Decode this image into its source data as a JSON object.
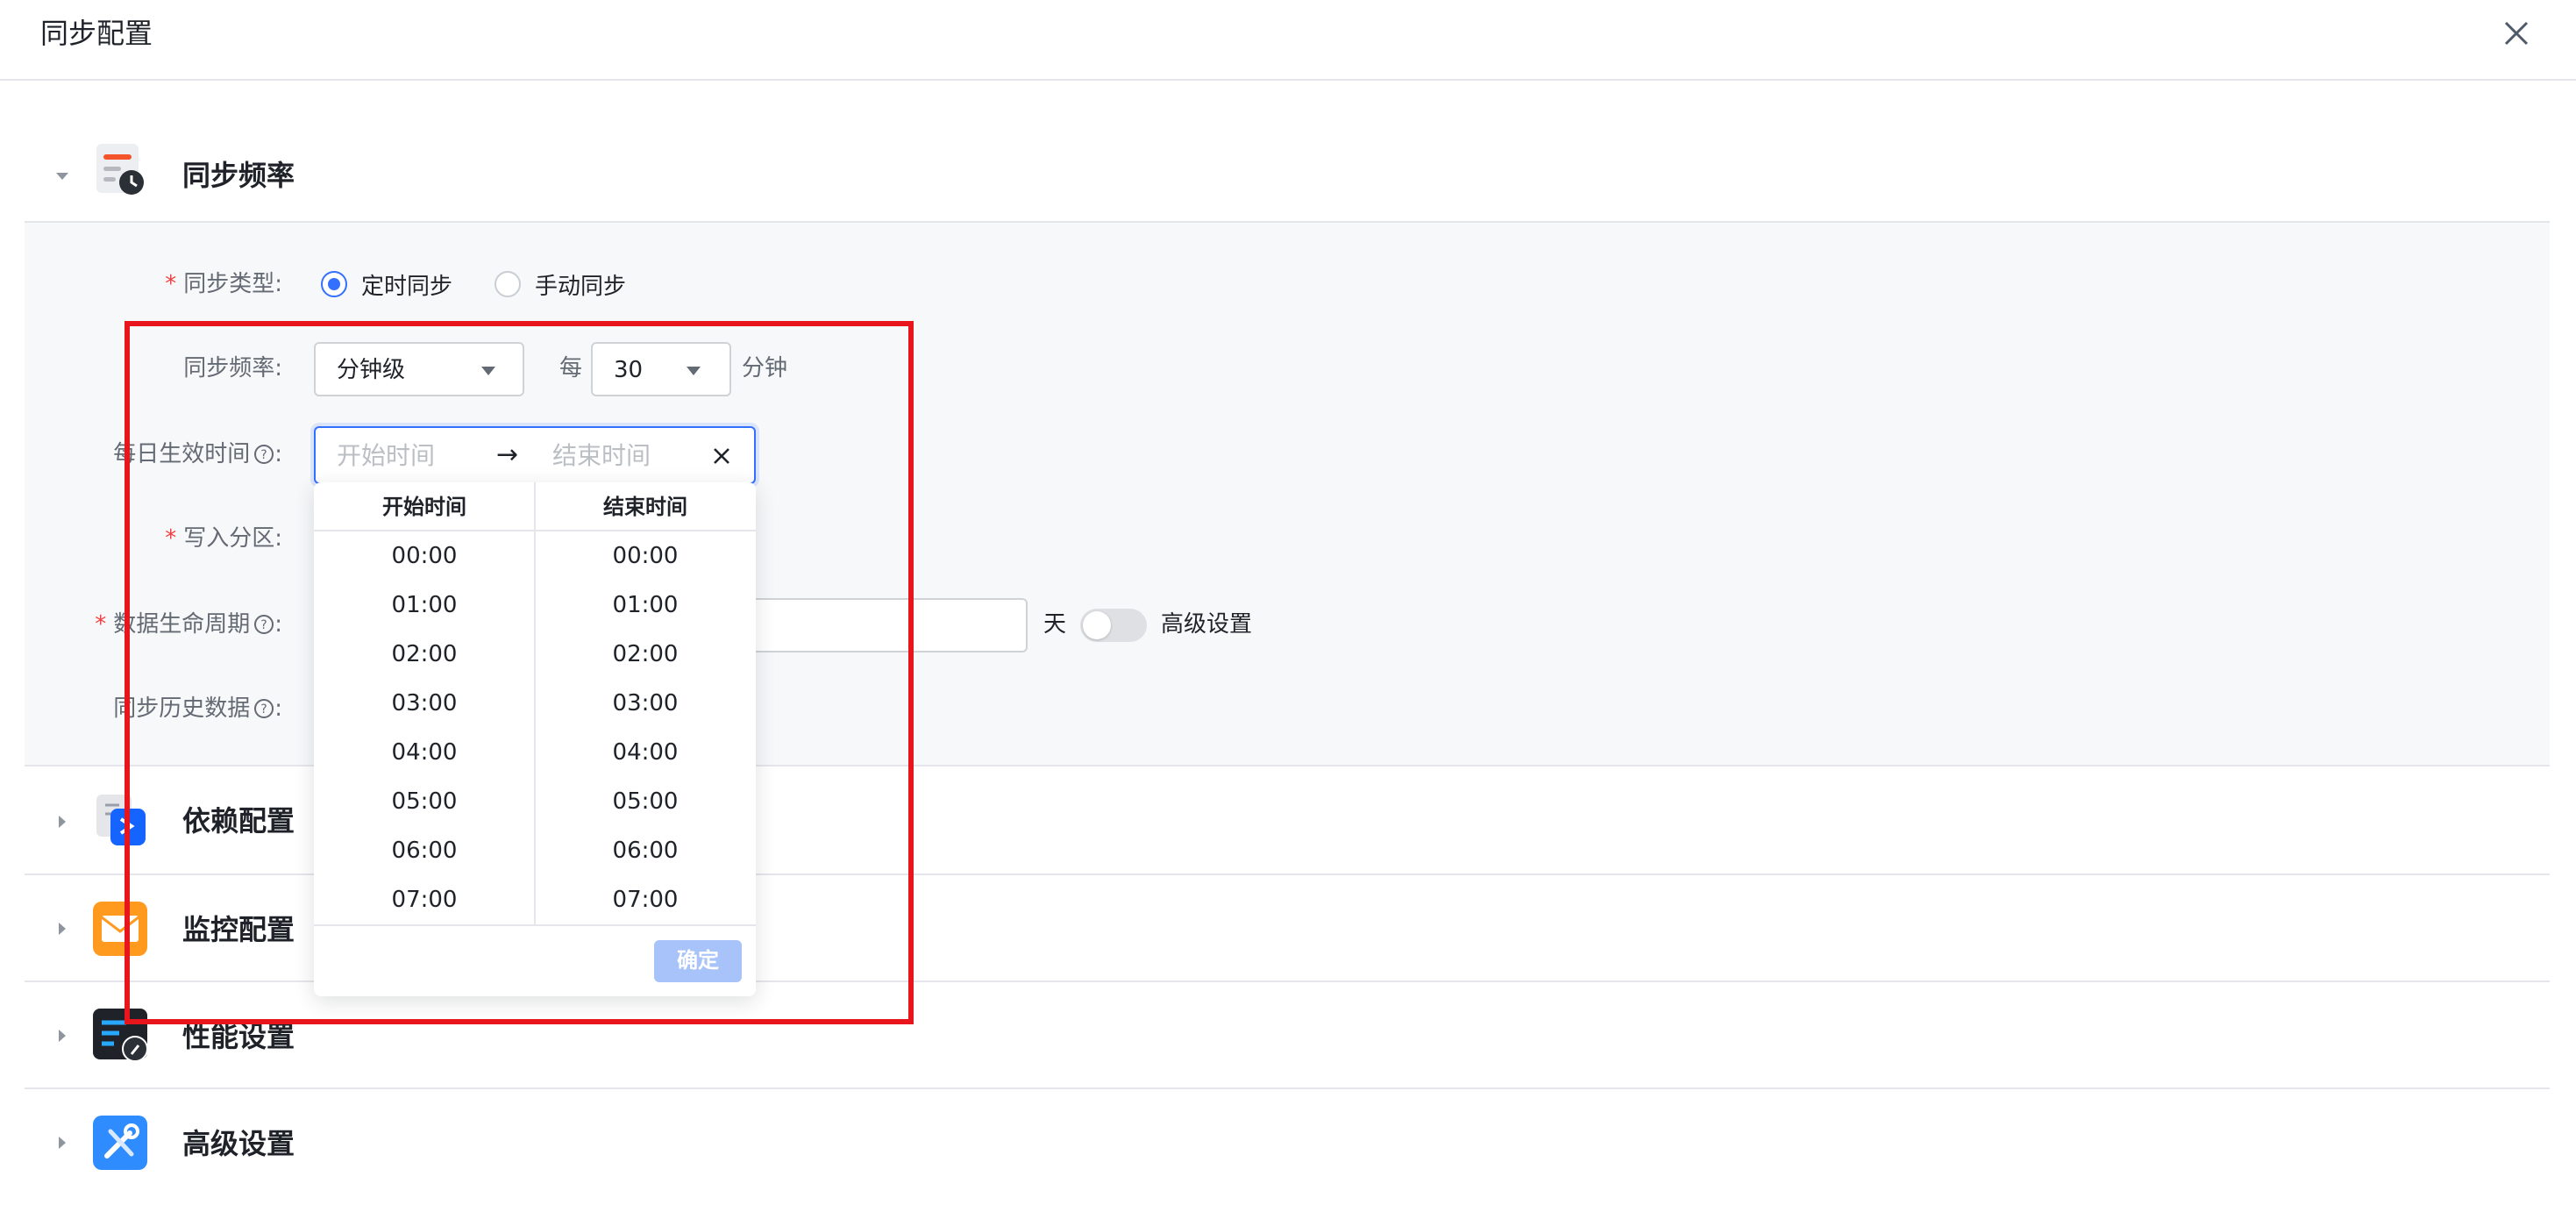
{
  "dialog": {
    "title": "同步配置"
  },
  "sections": {
    "frequency": {
      "title": "同步频率"
    },
    "dependency": {
      "title": "依赖配置"
    },
    "monitoring": {
      "title": "监控配置"
    },
    "performance": {
      "title": "性能设置"
    },
    "advanced": {
      "title": "高级设置"
    }
  },
  "form": {
    "sync_type": {
      "label": "同步类型:",
      "options": [
        "定时同步",
        "手动同步"
      ],
      "selected": "定时同步"
    },
    "sync_frequency": {
      "label": "同步频率:",
      "level": "分钟级",
      "every_label": "每",
      "interval": "30",
      "unit": "分钟"
    },
    "daily_time": {
      "label": "每日生效时间",
      "colon": ":",
      "start_placeholder": "开始时间",
      "end_placeholder": "结束时间",
      "separator": "→"
    },
    "partition": {
      "label": "写入分区:"
    },
    "lifecycle": {
      "label": "数据生命周期",
      "colon": ":",
      "unit": "天",
      "advanced_label": "高级设置",
      "advanced_enabled": false
    },
    "history": {
      "label": "同步历史数据",
      "colon": ":"
    }
  },
  "time_picker": {
    "start_header": "开始时间",
    "end_header": "结束时间",
    "start_times": [
      "00:00",
      "01:00",
      "02:00",
      "03:00",
      "04:00",
      "05:00",
      "06:00",
      "07:00"
    ],
    "end_times": [
      "00:00",
      "01:00",
      "02:00",
      "03:00",
      "04:00",
      "05:00",
      "06:00",
      "07:00"
    ],
    "confirm_label": "确定"
  },
  "colors": {
    "primary": "#3370ff",
    "required": "#f53f3f",
    "highlight": "#e8151c"
  }
}
